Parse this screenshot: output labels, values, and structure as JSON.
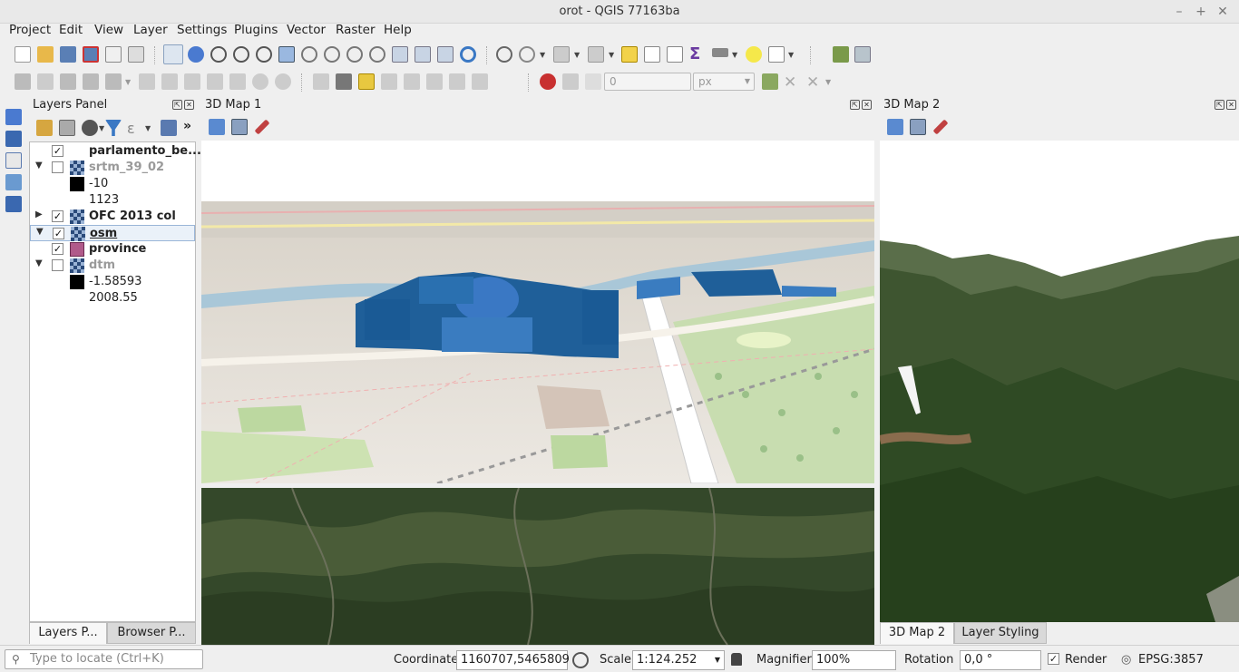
{
  "window": {
    "title": "orot - QGIS 77163ba"
  },
  "menu": [
    "Project",
    "Edit",
    "View",
    "Layer",
    "Settings",
    "Plugins",
    "Vector",
    "Raster",
    "Help"
  ],
  "toolbar2": {
    "offset_value": "0",
    "unit": "px"
  },
  "layers_panel": {
    "title": "Layers Panel",
    "layers": [
      {
        "name": "parlamento_be...",
        "checked": true,
        "expanded": null,
        "icon": "vector-icon",
        "disabled": false
      },
      {
        "name": "srtm_39_02",
        "checked": false,
        "expanded": true,
        "icon": "raster-icon",
        "disabled": true
      },
      {
        "legend": "-10"
      },
      {
        "legend": "1123",
        "noswatch": true
      },
      {
        "name": "OFC 2013 col",
        "checked": true,
        "expanded": false,
        "icon": "raster-icon",
        "disabled": false
      },
      {
        "name": "osm",
        "checked": true,
        "expanded": true,
        "icon": "raster-icon",
        "disabled": false,
        "selected": true
      },
      {
        "name": "province",
        "checked": true,
        "expanded": null,
        "icon": "polygon-icon",
        "disabled": false
      },
      {
        "name": "dtm",
        "checked": false,
        "expanded": true,
        "icon": "raster-icon",
        "disabled": true
      },
      {
        "legend": "-1.58593"
      },
      {
        "legend": "2008.55",
        "noswatch": true
      }
    ],
    "tabs": [
      "Layers P...",
      "Browser P..."
    ]
  },
  "map1": {
    "title": "3D Map 1"
  },
  "map2": {
    "title": "3D Map 2",
    "tabs": [
      "3D Map 2",
      "Layer Styling"
    ]
  },
  "statusbar": {
    "locator_placeholder": "Type to locate (Ctrl+K)",
    "coordinate_label": "Coordinate",
    "coordinate_value": "1160707,5465809",
    "scale_label": "Scale",
    "scale_value": "1:124.252",
    "magnifier_label": "Magnifier",
    "magnifier_value": "100%",
    "rotation_label": "Rotation",
    "rotation_value": "0,0 °",
    "render_label": "Render",
    "render_checked": true,
    "crs": "EPSG:3857"
  },
  "colors": {
    "building": "#1f5f99",
    "accent": "#3a78c4",
    "forest": "#2f4a24"
  }
}
